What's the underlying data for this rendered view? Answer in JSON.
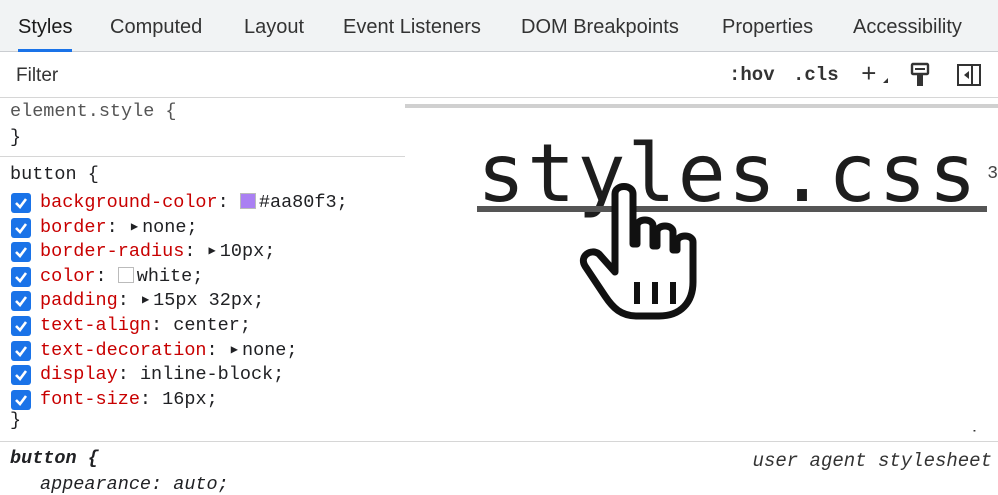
{
  "tabs": [
    {
      "label": "Styles",
      "active": true
    },
    {
      "label": "Computed"
    },
    {
      "label": "Layout"
    },
    {
      "label": "Event Listeners"
    },
    {
      "label": "DOM Breakpoints"
    },
    {
      "label": "Properties"
    },
    {
      "label": "Accessibility"
    }
  ],
  "filter": {
    "placeholder": "Filter"
  },
  "toolbar": {
    "hov": ":hov",
    "cls": ".cls",
    "new_rule": "+",
    "icons": [
      "paint-icon",
      "toggle-sidebar-icon"
    ]
  },
  "element_style": {
    "selector": "element.style {",
    "close": "}"
  },
  "rule": {
    "selector": "button {",
    "close": "}",
    "declarations": [
      {
        "prop": "background-color",
        "value": "#aa80f3",
        "swatch": "#aa80f3",
        "checked": true
      },
      {
        "prop": "border",
        "value": "none",
        "expandable": true,
        "checked": true
      },
      {
        "prop": "border-radius",
        "value": "10px",
        "expandable": true,
        "checked": true
      },
      {
        "prop": "color",
        "value": "white",
        "swatch": "#ffffff",
        "checked": true
      },
      {
        "prop": "padding",
        "value": "15px 32px",
        "expandable": true,
        "checked": true
      },
      {
        "prop": "text-align",
        "value": "center",
        "checked": true
      },
      {
        "prop": "text-decoration",
        "value": "none",
        "expandable": true,
        "checked": true
      },
      {
        "prop": "display",
        "value": "inline-block",
        "checked": true
      },
      {
        "prop": "font-size",
        "value": "16px",
        "checked": true
      }
    ]
  },
  "source_link": "styles.css",
  "source_line_suffix": "3",
  "ua_rule": {
    "selector": "button {",
    "source": "user agent stylesheet",
    "first_decl": "appearance: auto;"
  },
  "add_button": "+",
  "colors": {
    "accent": "#1a73e8",
    "prop": "#c80000",
    "swatch_purple": "#aa80f3"
  }
}
